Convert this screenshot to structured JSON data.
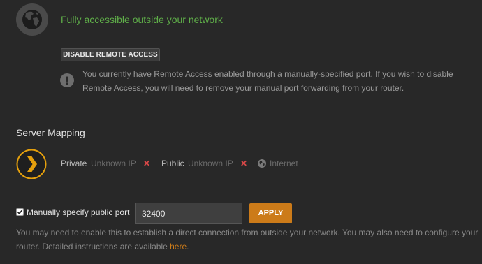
{
  "remote_access": {
    "status": "Fully accessible outside your network",
    "status_color": "#5fae49",
    "globe_icon": "globe-icon",
    "disable_button": "DISABLE REMOTE ACCESS",
    "warning_icon": "exclamation-icon",
    "warning_text": "You currently have Remote Access enabled through a manually-specified port. If you wish to disable Remote Access, you will need to remove your manual port forwarding from your router."
  },
  "server_mapping": {
    "title": "Server Mapping",
    "logo_icon": "plex-chevron-icon",
    "private_label": "Private",
    "private_ip": "Unknown IP",
    "public_label": "Public",
    "public_ip": "Unknown IP",
    "error_glyph": "✕",
    "internet_icon": "globe-icon",
    "internet_label": "Internet"
  },
  "manual_port": {
    "checked": true,
    "label": "Manually specify public port",
    "port_value": "32400",
    "apply_button": "APPLY",
    "help_text": "You may need to enable this to establish a direct connection from outside your network. You may also need to configure your router. Detailed instructions are available ",
    "help_link": "here",
    "help_end": "."
  },
  "colors": {
    "background": "#282828",
    "accent": "#cc7b19",
    "error": "#d84848"
  }
}
